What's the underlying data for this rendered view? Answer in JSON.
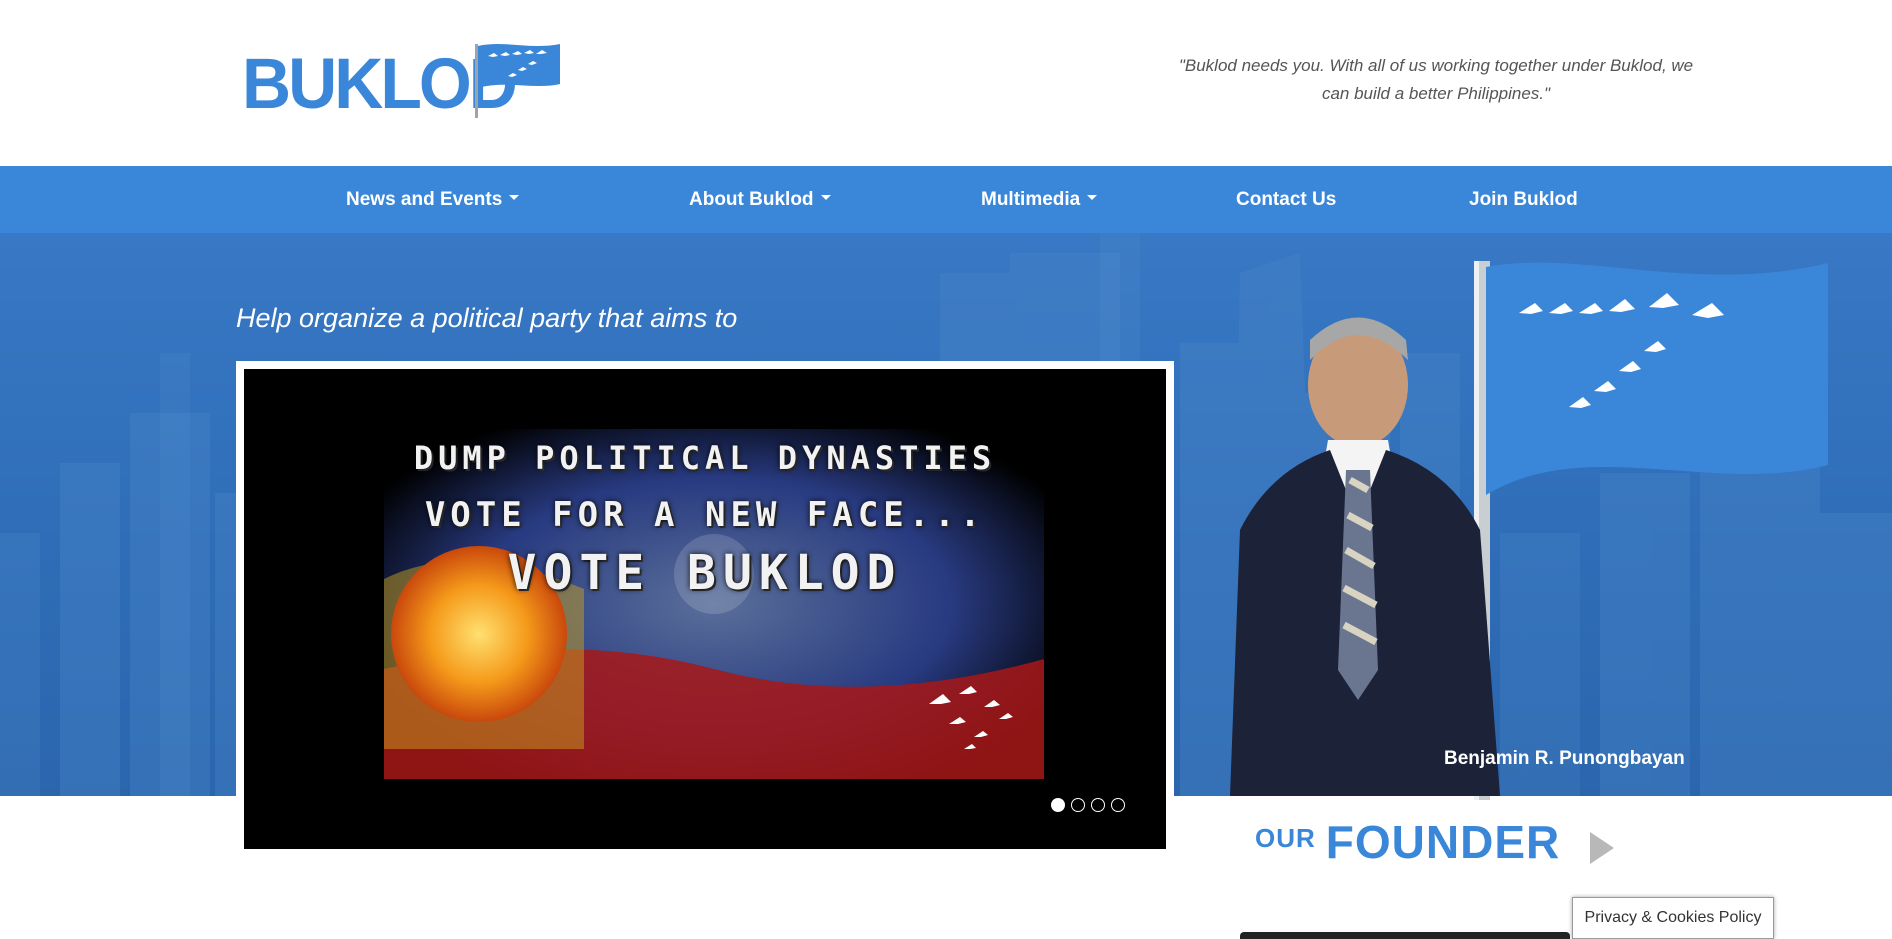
{
  "header": {
    "logo_text": "BUKLOD",
    "quote": "\"Buklod needs you. With all of us working together under Buklod, we can build a better Philippines.\""
  },
  "nav": {
    "items": [
      {
        "label": "News and Events",
        "has_dropdown": true
      },
      {
        "label": "About Buklod",
        "has_dropdown": true
      },
      {
        "label": "Multimedia",
        "has_dropdown": true
      },
      {
        "label": "Contact Us",
        "has_dropdown": false
      },
      {
        "label": "Join Buklod",
        "has_dropdown": false
      }
    ]
  },
  "hero": {
    "tagline": "Help organize a political party that aims to",
    "slide": {
      "line1": "DUMP POLITICAL DYNASTIES",
      "line2": "VOTE FOR A NEW FACE...",
      "line3": "VOTE BUKLOD"
    },
    "slider_dots": {
      "count": 4,
      "active_index": 0
    },
    "founder_name": "Benjamin R. Punongbayan"
  },
  "founder_section": {
    "our": "OUR",
    "founder": "FOUNDER"
  },
  "privacy_button": "Privacy & Cookies Policy",
  "colors": {
    "brand_blue": "#3a87d9",
    "hero_blue": "#2f6db8",
    "slider_bg": "#000000"
  },
  "icons": [
    "caret-down-icon",
    "flag-icon",
    "play-arrow-icon",
    "bird-icon"
  ]
}
